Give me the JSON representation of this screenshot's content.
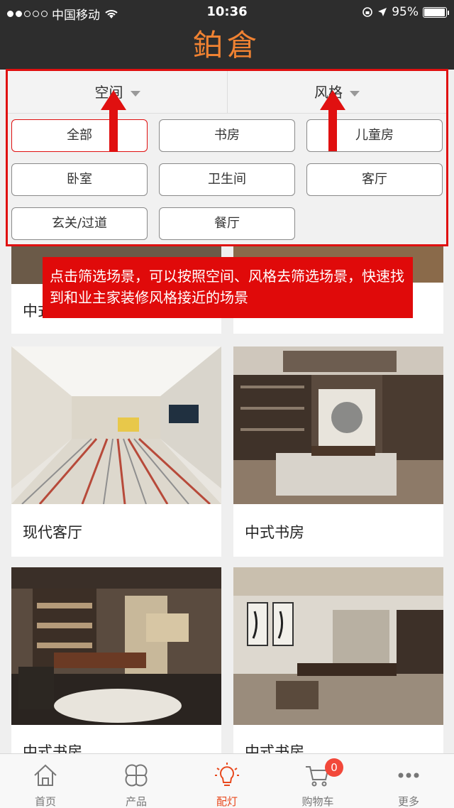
{
  "status_bar": {
    "carrier": "中国移动",
    "time": "10:36",
    "battery": "95%",
    "battery_level": 0.95
  },
  "header": {
    "logo": "鉑倉"
  },
  "filter": {
    "tabs": [
      {
        "label": "空间"
      },
      {
        "label": "风格"
      }
    ],
    "options": [
      {
        "label": "全部"
      },
      {
        "label": "书房"
      },
      {
        "label": "儿童房"
      },
      {
        "label": "卧室"
      },
      {
        "label": "卫生间"
      },
      {
        "label": "客厅"
      },
      {
        "label": "玄关/过道"
      },
      {
        "label": "餐厅"
      }
    ],
    "selected": "全部"
  },
  "callout": "点击筛选场景，可以按照空间、风格去筛选场景，快速找到和业主家装修风格接近的场景",
  "cards": [
    {
      "title": "中式"
    },
    {
      "title": ""
    },
    {
      "title": "现代客厅"
    },
    {
      "title": "中式书房"
    },
    {
      "title": "中式书房"
    },
    {
      "title": "中式书房"
    }
  ],
  "tabbar": {
    "items": [
      {
        "label": "首页"
      },
      {
        "label": "产品"
      },
      {
        "label": "配灯"
      },
      {
        "label": "购物车"
      },
      {
        "label": "更多"
      }
    ],
    "cart_badge": "0",
    "active": "配灯"
  },
  "colors": {
    "accent": "#e01010",
    "brand": "#f08232",
    "header_bg": "#2d2d2d"
  }
}
